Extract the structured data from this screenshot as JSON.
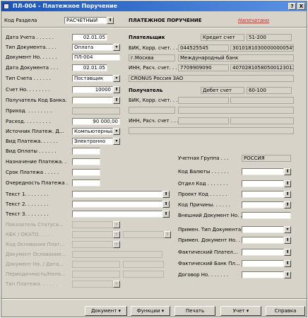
{
  "window": {
    "title": "ПЛ-004 - Платежное Поручение",
    "close": "X",
    "help": "?"
  },
  "header": {
    "section_label": "Код Раздела",
    "section_value": "РАСЧЕТНЫЙ",
    "doc_title": "ПЛАТЕЖНОЕ ПОРУЧЕНИЕ",
    "status": "Напечатано",
    "status_color": "#e02020"
  },
  "left": {
    "account_date_label": "Дата Учета . . . . . .",
    "account_date": "02.01.05",
    "doc_type_label": "Тип Документа. . . .",
    "doc_type": "Оплата",
    "doc_no_label": "Документ Но. . . . . .",
    "doc_no": "ПЛ-004",
    "doc_date_label": "Дата Документа . . .",
    "doc_date": "02.01.05",
    "account_type_label": "Тип Счета . . . . . .",
    "account_type": "Поставщик",
    "account_no_label": "Счет Но. . . . . . . .",
    "account_no": "10000",
    "recipient_bank_label": "Получатель Код Банка.",
    "income_label": "Приход. . . . . . . . .",
    "expense_label": "Расход. . . . . . . . .",
    "expense": "90 000,00",
    "pay_source_label": "Источник Платеж. Д...",
    "pay_source": "Компьютерный",
    "pay_kind_label": "Вид Платежа. . . . . .",
    "pay_kind": "Электронно",
    "payment_kind_label": "Вид Оплаты . . . . . .",
    "purpose_label": "Назначение Платежа. .",
    "term_label": "Срок Платежа . . . . .",
    "order_label": "Очередность Платежа .",
    "text1_label": "Текст 1. . . . . . . .",
    "text2_label": "Текст 2. . . . . . . .",
    "text3_label": "Текст 3. . . . . . . .",
    "status_indicator_label": "Показатель Статуса...",
    "kbk_label": "КБК / ОКАТО. . . . .",
    "basis_code_label": "Код Основания Плат...",
    "doc_basis_label": "Документ Основание...",
    "doc_no_date_label": "Документ Но. / Дата...",
    "periodicity_label": "Периодичность/Напо...",
    "pay_type_label": "Тип Платежа. . . . . ."
  },
  "payer": {
    "label": "Плательщик",
    "credit_label": "Кредит счет",
    "credit_value": "51-200",
    "bik_label": "БИК, Корр. счет. . .",
    "bik": "044525545",
    "corr": "30101810300000000545",
    "city": "г.Москва",
    "bank": "Международный банк",
    "inn_label": "ИНН, Расч. счет. . .",
    "inn": "7709909090",
    "account": "40702810580500123012",
    "name": "CRONUS Россия ЗАО"
  },
  "recipient": {
    "label": "Получатель",
    "debit_label": "Дебет счет",
    "debit_value": "60-100",
    "bik_label": "БИК, Корр. счет. . .",
    "inn_label": "ИНН, Расч. счет . . ."
  },
  "right": {
    "account_group_label": "Учетная Группа . . .",
    "account_group": "РОССИЯ",
    "currency_label": "Код Валюты . . . . . .",
    "dept_label": "Отдел Код . . . . . . .",
    "project_label": "Проект Код . . . . . .",
    "reason_label": "Код Причины. . . . . .",
    "ext_doc_label": "Внешний Документ Но. .",
    "apply_type_label": "Примен. Тип Документа",
    "apply_no_label": "Примен. Документ Но. .",
    "actual_payer_label": "Фактический Плател...",
    "actual_bank_label": "Фактический Банк Пл...",
    "contract_label": "Договор Но. . . . . . ."
  },
  "buttons": {
    "document": "Документ",
    "functions": "Функции",
    "print": "Печать",
    "posting": "Учет",
    "help": "Справка"
  },
  "icons": {
    "lookup": "⬆",
    "dropdown": "▾"
  }
}
